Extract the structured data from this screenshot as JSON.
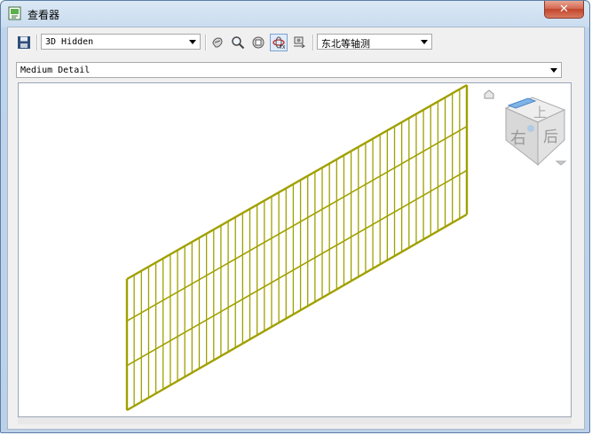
{
  "window": {
    "title": "查看器",
    "close_label": "✕"
  },
  "toolbar": {
    "visual_style": "3D Hidden",
    "view_orientation": "东北等轴测"
  },
  "detail": {
    "level": "Medium Detail"
  },
  "viewcube": {
    "top_face": "上",
    "left_face": "右",
    "right_face": "后"
  },
  "colors": {
    "grid_line": "#a0a000",
    "title_bar": "#c9dcef",
    "close_button": "#c2452c"
  }
}
